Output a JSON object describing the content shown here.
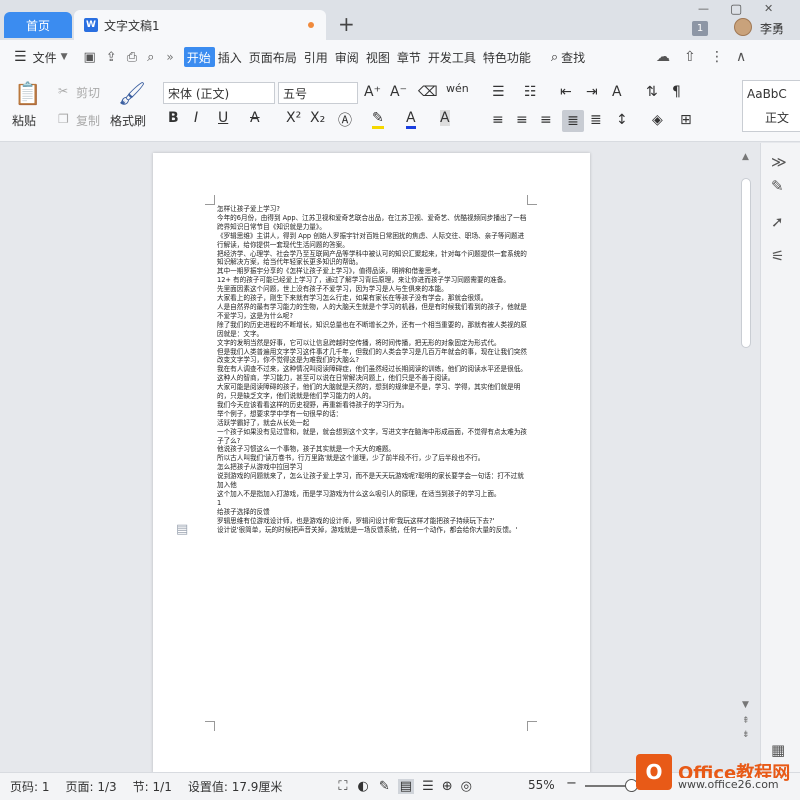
{
  "tabs": {
    "home": "首页",
    "doc": "文字文稿1",
    "doc_icon": "W",
    "new": "+"
  },
  "account": {
    "count": "1",
    "name": "李勇"
  },
  "window": {
    "minimize": "—",
    "maximize": "▢",
    "close": "✕"
  },
  "menubar": {
    "file": "文件",
    "items": [
      "开始",
      "插入",
      "页面布局",
      "引用",
      "审阅",
      "视图",
      "章节",
      "开发工具",
      "特色功能"
    ],
    "active_index": 0,
    "search": "查找",
    "more": "»"
  },
  "ribbon": {
    "paste": "粘贴",
    "cut": "剪切",
    "copy": "复制",
    "format_painter": "格式刷",
    "font": "宋体 (正文)",
    "size": "五号",
    "style_preview": "AaBbC",
    "style_name": "正文"
  },
  "document": {
    "text": "怎样让孩子爱上学习?\n今年的6月份，由得到 App、江苏卫视和爱奇艺联合出品，在江苏卫视、爱奇艺、优酷视频同步播出了一档跨界知识日常节目《知识就是力量》。\n《罗辑思维》主讲人，得到 App 创始人罗振宇针对百姓日常困扰的焦虑、人际交往、职场、亲子等问题进行解读，给你提供一套现代生活问题的答案。\n把经济学、心理学、社会学乃至互联网产品等学科中被认可的知识汇聚起来，针对每个问题提供一套系统的知识解决方案，给当代年轻家长更多知识的帮助。\n其中一期罗振宇分享的《怎样让孩子爱上学习》，值得品读，明辨和借鉴思考。\n12+ 有的孩子可能已经爱上学习了，通过了解学习背后原理，来让你进而孩子学习同题需要的准备。\n先里面因素这个问题，世上没有孩子不爱学习，因为学习是人与生俱来的本能。\n大家看上的孩子，刚生下来就有学习怎么行走，如果有家长在等孩子没有学会，那就会很烦。\n人是自然界的最有学习能力的生物，人的大脑天生就是个学习的机器，但是有时候我们看到的孩子，他就是不爱学习，这是为什么呢?\n除了我们的历史进程的不断增长，知识总量也在不断增长之外，还有一个相当重要的，那就有被人类视的原因就是：文字。\n文字的发明当然是好事，它可以让信息跨越时空传播，将时间传播，把无形的对象固定为形式代。\n但是我们人类普遍用文字学习这件事才几千年，但我们的人类会学习是几百万年就会的事，现在让我们突然改变文字学习，你不觉得这是为难我们的大脑么?\n我在有人调查不过来，这种情况叫阅读障碍症，他们虽然经过长期阅读的训练，他们的阅读水平还是很低。\n这种人的智商，学习能力，甚至可以说在日常解决问题上，他们只是不善于阅读。\n大家可能是阅读障碍的孩子，他们的大脑就是天然的，想到的规律是不是，学习、学得，其实他们就是明的，只是缺乏文字，他们说就是他们学习能力的人的。\n我们今天应该看看这样的历史视野，再重新看待孩子的学习行为。\n举个例子，想要求学中学有一句很早的话：\n活跃学霸好了，就会从长处一起\n一个孩子如果没有见过雪和，就是，就会想到这个文字，写进文字在脑海中形成画面，不觉得有点太难为孩子了么?\n他说孩子习惯这么一个事物，孩子其实就是一个天大的难题。\n所以古人叫我们'读万卷书，行万里路'就是这个道理，少了前半段不行，少了后半段也不行。\n怎么把孩子从游戏中拉回学习\n说到游戏的问题就来了，怎么让孩子爱上学习，而不是天天玩游戏呢?聪明的家长要学会一句话：打不过就加入他\n这个加入不是指加入打游戏，而是学习游戏为什么这么吸引人的原理，在适当到孩子的学习上面。\n1\n给孩子选择的反馈\n罗辑思维有位游戏设计师，也是游戏的设计师，罗辑问设计师'我玩这样才能把孩子持续玩下去?'\n设计说'很简单，玩的时候把声音关掉，游戏就是一场反馈系统，任何一个动作，都会给你大量的反馈。'"
  },
  "status": {
    "page_no": "页码: 1",
    "pages": "页面: 1/3",
    "section": "节: 1/1",
    "setting": "设置值: 17.9厘米",
    "zoom": "55%",
    "zoom_minus": "−",
    "zoom_plus": "+"
  },
  "brand": {
    "logo": "O",
    "name": "Office教程网",
    "url": "www.office26.com"
  },
  "colors": {
    "accent": "#3b8cf0",
    "brand": "#e85a17"
  }
}
